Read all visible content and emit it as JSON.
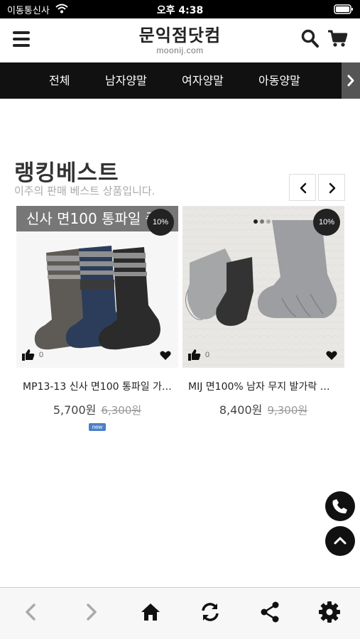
{
  "status_bar": {
    "carrier": "이동통신사",
    "time": "오후 4:38"
  },
  "header": {
    "logo_name": "문익점닷컴",
    "logo_domain": "moonij.com"
  },
  "nav": {
    "tabs": [
      "전체",
      "남자양말",
      "여자양말",
      "아동양말"
    ]
  },
  "ranking": {
    "title": "랭킹베스트",
    "subtitle": "이주의 판매 베스트 상품입니다."
  },
  "products": [
    {
      "banner": "신사 면100 통파일 중",
      "discount": "10%",
      "likes": "0",
      "name": "MP13-13 신사 면100 통파일 가…",
      "price": "5,700원",
      "old_price": "6,300원",
      "badge": "new"
    },
    {
      "discount": "10%",
      "likes": "0",
      "name": "MIJ 면100% 남자 무지 발가락 중…",
      "price": "8,400원",
      "old_price": "9,300원"
    }
  ],
  "colors": {
    "nav_bg": "#111111",
    "accent": "#4a7ec9"
  },
  "icons": [
    "wifi-icon",
    "battery-icon",
    "menu-icon",
    "search-icon",
    "cart-icon",
    "phone-icon",
    "chevron-up-icon",
    "home-icon",
    "refresh-icon",
    "share-icon",
    "gear-icon"
  ]
}
